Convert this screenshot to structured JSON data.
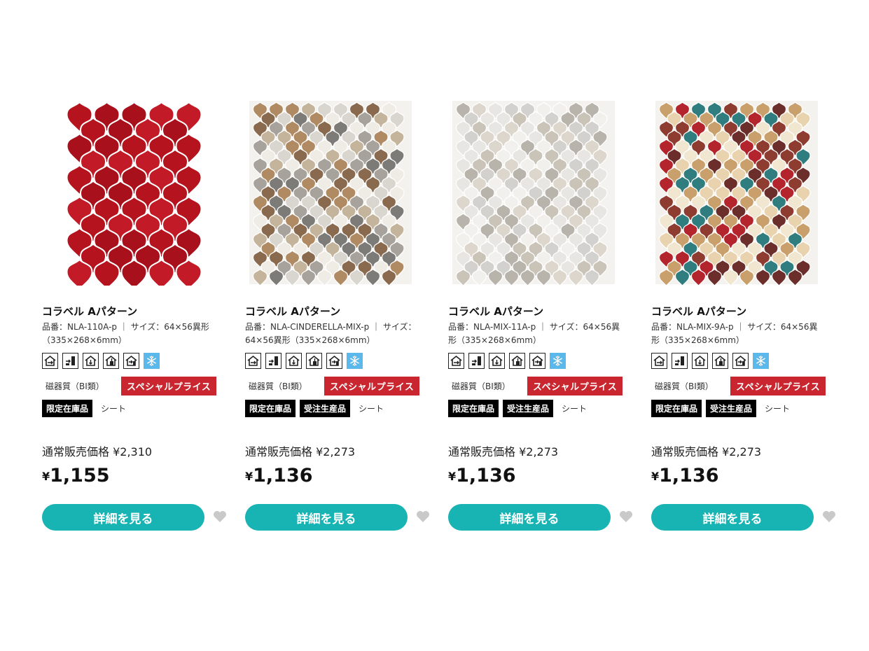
{
  "products": [
    {
      "title": "コラベル Aパターン",
      "meta": "品番：NLA-110A-p ｜ サイズ：64×56異形（335×268×6mm）",
      "material": "磁器質（BI類）",
      "special": "スペシャルプライス",
      "tags": [
        "限定在庫品"
      ],
      "sheet": "シート",
      "regular_price": "通常販売価格 ¥2,310",
      "yen": "¥",
      "price": "1,155",
      "button": "詳細を見る",
      "swatch": "red",
      "colors": [
        "#b5141f",
        "#c21a26",
        "#a8101b"
      ]
    },
    {
      "title": "コラベル Aパターン",
      "meta": "品番：NLA-CINDERELLA-MIX-p ｜ サイズ：64×56異形（335×268×6mm）",
      "material": "磁器質（BI類）",
      "special": "スペシャルプライス",
      "tags": [
        "限定在庫品",
        "受注生産品"
      ],
      "sheet": "シート",
      "regular_price": "通常販売価格 ¥2,273",
      "yen": "¥",
      "price": "1,136",
      "button": "詳細を見る",
      "swatch": "cinderella-mix",
      "colors": [
        "#8a6a4e",
        "#a7a39c",
        "#d9d5cf",
        "#c4b49b",
        "#7d7b78",
        "#efece6",
        "#b08a62"
      ]
    },
    {
      "title": "コラベル Aパターン",
      "meta": "品番：NLA-MIX-11A-p ｜ サイズ：64×56異形（335×268×6mm）",
      "material": "磁器質（BI類）",
      "special": "スペシャルプライス",
      "tags": [
        "限定在庫品",
        "受注生産品"
      ],
      "sheet": "シート",
      "regular_price": "通常販売価格 ¥2,273",
      "yen": "¥",
      "price": "1,136",
      "button": "詳細を見る",
      "swatch": "mix-11",
      "colors": [
        "#e8e6e2",
        "#d3d1cd",
        "#f2f0ec",
        "#c9c3b8",
        "#b8b3ab",
        "#dcd6cc"
      ]
    },
    {
      "title": "コラベル Aパターン",
      "meta": "品番：NLA-MIX-9A-p ｜ サイズ：64×56異形（335×268×6mm）",
      "material": "磁器質（BI類）",
      "special": "スペシャルプライス",
      "tags": [
        "限定在庫品",
        "受注生産品"
      ],
      "sheet": "シート",
      "regular_price": "通常販売価格 ¥2,273",
      "yen": "¥",
      "price": "1,136",
      "button": "詳細を見る",
      "swatch": "mix-9",
      "colors": [
        "#b3242c",
        "#2f7d7f",
        "#6b2e2a",
        "#e8d3ae",
        "#c9a06b",
        "#f1e6cf",
        "#8e3b30"
      ]
    }
  ],
  "usage_icons": [
    "interior-wall-icon",
    "exterior-wall-icon",
    "interior-floor-icon",
    "exterior-floor-icon",
    "water-area-icon",
    "frost-resistant-icon"
  ],
  "accent": "#18b3b3",
  "special_color": "#c9262f"
}
